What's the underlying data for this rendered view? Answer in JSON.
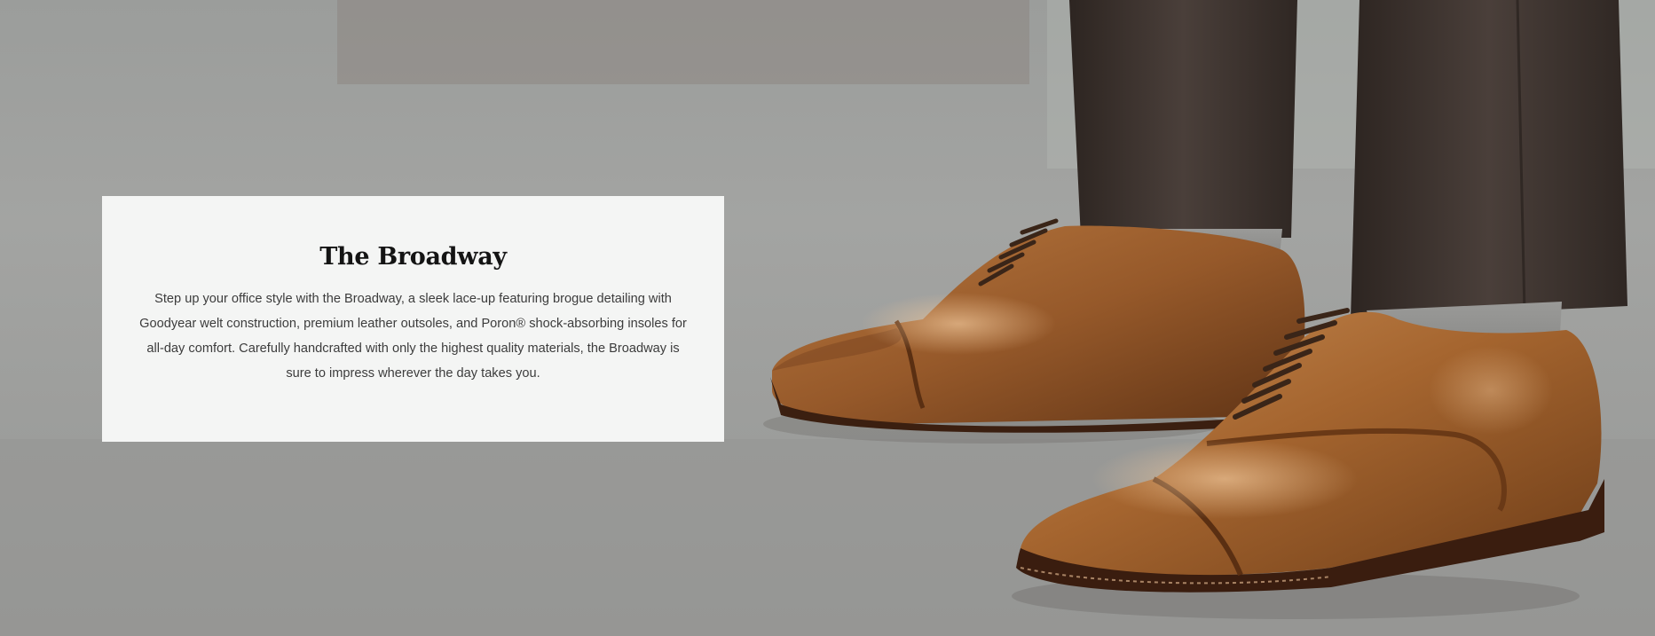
{
  "hero": {
    "image_alt": "Brown leather cap-toe oxford dress shoes worn with grey trousers on a concrete sidewalk"
  },
  "card": {
    "title": "The Broadway",
    "description": "Step up your office style with the Broadway, a sleek lace-up featuring brogue detailing with Goodyear welt construction, premium leather outsoles, and Poron® shock-absorbing insoles for all-day comfort. Carefully handcrafted with only the highest quality materials, the Broadway is sure to impress wherever the day takes you."
  },
  "colors": {
    "ground": "#a0a19f",
    "card_background": "#f4f5f4",
    "title": "#141414",
    "body_text": "#3c3c3c",
    "leather": "#a5652f",
    "trousers": "#3f3531",
    "socks": "#8a8a88"
  }
}
